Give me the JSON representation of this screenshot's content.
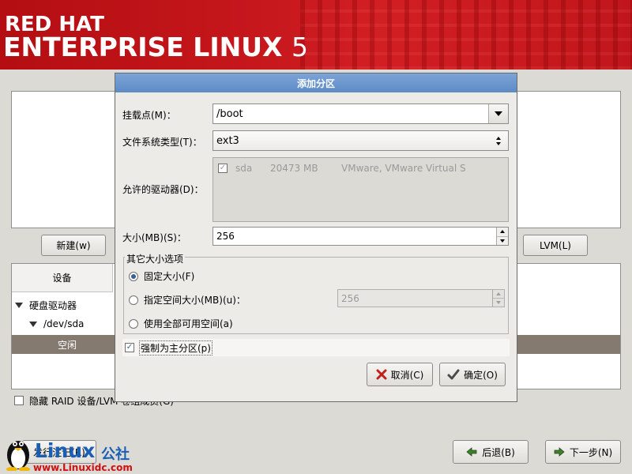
{
  "banner": {
    "line1": "RED HAT",
    "line2_text": "ENTERPRISE LINUX",
    "line2_version": "5"
  },
  "background": {
    "new_button": "新建(w)",
    "lvm_button": "LVM(L)",
    "tree_header": "设备",
    "tree": [
      {
        "label": "硬盘驱动器",
        "level": 0,
        "expanded": true
      },
      {
        "label": "/dev/sda",
        "level": 1,
        "expanded": true
      },
      {
        "label": "空闲",
        "level": 2,
        "selected": true
      }
    ],
    "hide_raid_label": "隐藏 RAID 设备/LVM 卷组成员(G)",
    "hide_raid_checked": false,
    "back_button": "后退(B)",
    "next_button": "下一步(N)",
    "release_notes_button": "发行注记(R)"
  },
  "dialog": {
    "title": "添加分区",
    "mount_point_label": "挂载点(M)：",
    "mount_point_value": "/boot",
    "fs_type_label": "文件系统类型(T)：",
    "fs_type_value": "ext3",
    "drives_label": "允许的驱动器(D)：",
    "drives": [
      {
        "checked": true,
        "name": "sda",
        "size": "20473 MB",
        "model": "VMware, VMware Virtual S"
      }
    ],
    "size_label": "大小(MB)(S)：",
    "size_value": "256",
    "other_size_title": "其它大小选项",
    "options": [
      {
        "label": "固定大小(F)",
        "selected": true
      },
      {
        "label": "指定空间大小(MB)(u)：",
        "selected": false
      },
      {
        "label": "使用全部可用空间(a)",
        "selected": false
      }
    ],
    "max_size_value": "256",
    "force_primary_label": "强制为主分区(p)",
    "force_primary_checked": true,
    "cancel_button": "取消(C)",
    "ok_button": "确定(O)"
  },
  "watermark": {
    "brand": "Linux",
    "brand_cn": "公社",
    "url": "www.Linuxidc.com"
  },
  "colors": {
    "banner_red": "#c5171c",
    "title_blue": "#6a95cc",
    "selection_brown": "#857a70"
  }
}
